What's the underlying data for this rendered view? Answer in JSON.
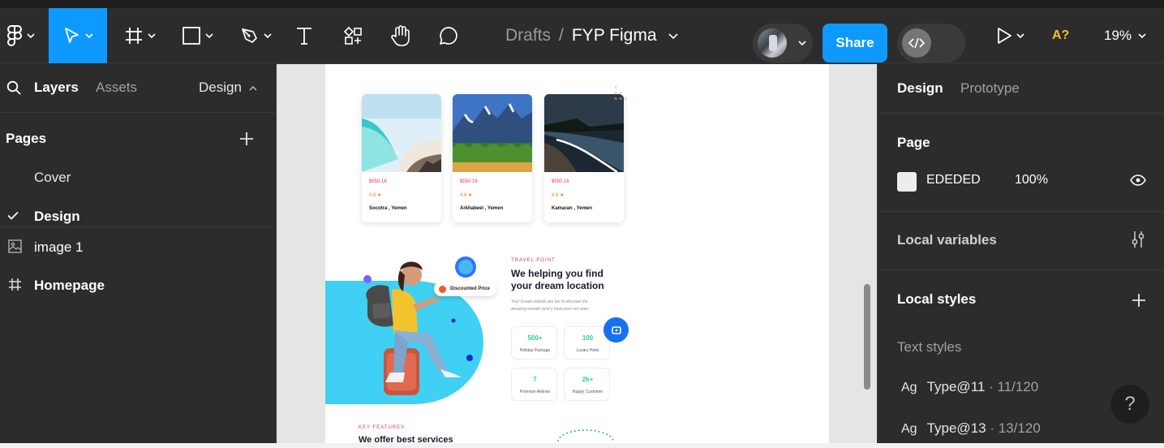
{
  "toolbar": {
    "breadcrumb_root": "Drafts",
    "breadcrumb_sep": "/",
    "file_name": "FYP Figma",
    "share_label": "Share",
    "accessibility_label": "A?",
    "zoom_level": "19%",
    "active_tool": "move",
    "accent_color": "#0d99ff"
  },
  "left_panel": {
    "tabs": {
      "layers": "Layers",
      "assets": "Assets"
    },
    "page_dropdown": "Design",
    "pages_heading": "Pages",
    "pages": [
      {
        "label": "Cover",
        "selected": false
      },
      {
        "label": "Design",
        "selected": true
      }
    ],
    "layers": [
      {
        "label": "image 1",
        "icon": "image-icon"
      },
      {
        "label": "Homepage",
        "icon": "frame-icon"
      }
    ]
  },
  "canvas": {
    "cards": [
      {
        "price": "$550.16",
        "rating": "4.8 ★",
        "name": "Socotra , Yemen"
      },
      {
        "price": "$550.16",
        "rating": "4.8 ★",
        "name": "Arkhabeel , Yemen"
      },
      {
        "price": "$550.16",
        "rating": "4.8 ★",
        "name": "Kamaran , Yemen"
      }
    ],
    "badge": "Discounted Price",
    "eyebrow": "TRAVEL POINT",
    "headline_1": "We helping you find",
    "headline_2": "your dream location",
    "subcopy_1": "Your Dream islands are her to discover the",
    "subcopy_2": "amazing wonder land y have ever not seen",
    "stats": [
      {
        "value": "500+",
        "label": "Holiday Package"
      },
      {
        "value": "100",
        "label": "Luxary Hotel"
      },
      {
        "value": "7",
        "label": "Premium Airlines"
      },
      {
        "value": "2k+",
        "label": "Happy Customer"
      }
    ],
    "features_eyebrow": "KEY FEATURES",
    "features_title": "We offer best services"
  },
  "right_panel": {
    "tabs": {
      "design": "Design",
      "prototype": "Prototype"
    },
    "page_heading": "Page",
    "page_fill_hex": "EDEDED",
    "page_fill_opacity": "100%",
    "local_variables": "Local variables",
    "local_styles": "Local styles",
    "text_styles": "Text styles",
    "styles": [
      {
        "ag": "Ag",
        "name": "Type@11",
        "meta": " · 11/120"
      },
      {
        "ag": "Ag",
        "name": "Type@13",
        "meta": " · 13/120"
      }
    ],
    "help": "?"
  }
}
